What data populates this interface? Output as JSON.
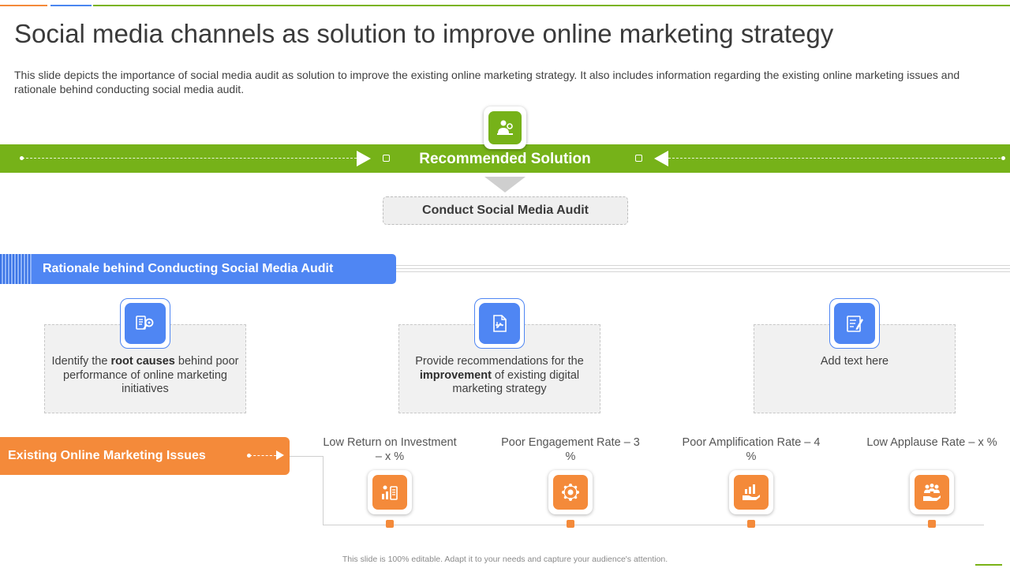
{
  "title": "Social media channels as solution to improve online marketing strategy",
  "description": "This slide depicts the importance of social media audit as solution to improve the existing online marketing strategy. It also includes information regarding the existing online marketing issues and rationale behind conducting social media audit.",
  "solution": {
    "label": "Recommended Solution",
    "icon": "person-presenting-icon",
    "action": "Conduct Social Media Audit"
  },
  "rationale": {
    "heading": "Rationale behind Conducting Social Media Audit",
    "cards": [
      {
        "icon": "report-search-icon",
        "pre": "Identify the ",
        "bold": "root causes",
        "post": " behind poor performance of online marketing initiatives"
      },
      {
        "icon": "document-chart-icon",
        "pre": "Provide recommendations for the ",
        "bold": "improvement",
        "post": " of existing digital marketing strategy"
      },
      {
        "icon": "notepad-icon",
        "pre": "Add text here",
        "bold": "",
        "post": ""
      }
    ]
  },
  "issues": {
    "heading": "Existing Online Marketing Issues",
    "items": [
      {
        "label": "Low Return on Investment – x %",
        "icon": "investment-chart-icon"
      },
      {
        "label": "Poor Engagement Rate – 3 %",
        "icon": "network-icon"
      },
      {
        "label": "Poor Amplification Rate – 4 %",
        "icon": "hand-chart-icon"
      },
      {
        "label": "Low Applause Rate – x %",
        "icon": "group-hand-icon"
      }
    ]
  },
  "footer": "This slide is 100% editable. Adapt it to your needs and capture your audience's attention.",
  "colors": {
    "green": "#76b219",
    "blue": "#4f86f3",
    "orange": "#f48a3a"
  }
}
